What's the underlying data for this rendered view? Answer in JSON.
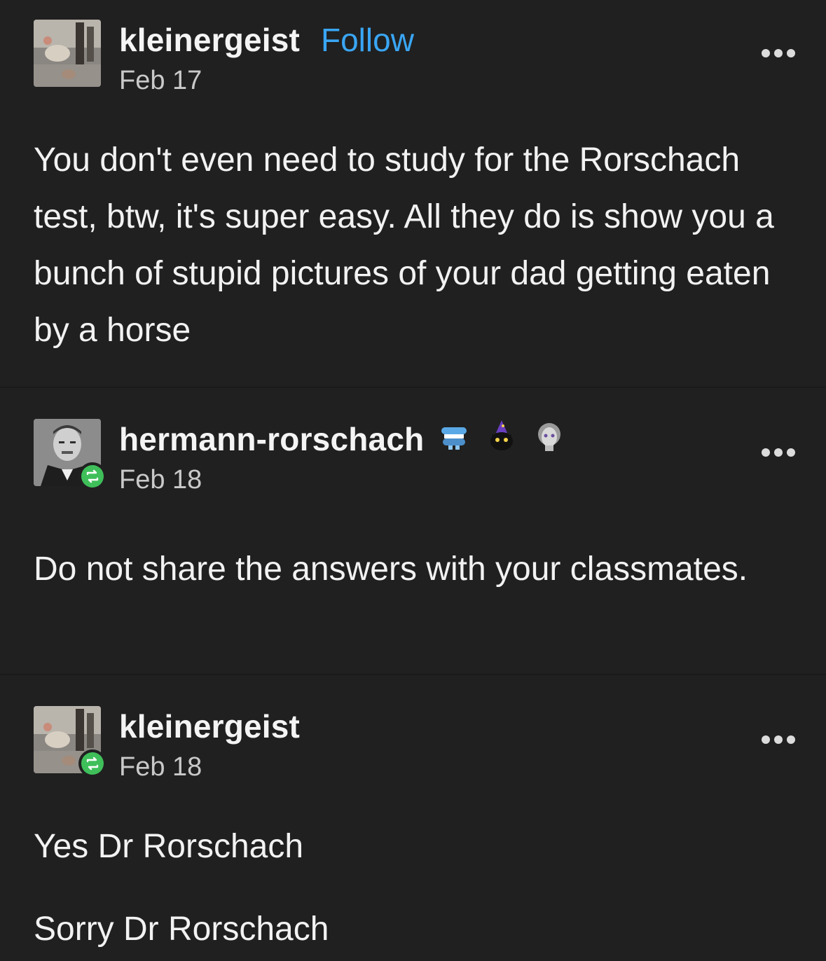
{
  "posts": [
    {
      "username": "kleinergeist",
      "follow_label": "Follow",
      "date": "Feb 17",
      "avatar_icon": "photo-collage-avatar",
      "reblogged": false,
      "paragraphs": [
        "You don't even need to study for the Rorschach test, btw, it's super easy. All they do is show you a bunch of stupid pictures of your dad getting eaten by a horse"
      ]
    },
    {
      "username": "hermann-rorschach",
      "date": "Feb 18",
      "avatar_icon": "portrait-photo-avatar",
      "reblogged": true,
      "badge_icons": [
        "chattering-teeth-badge-icon",
        "wizard-cat-badge-icon",
        "marble-bust-badge-icon"
      ],
      "paragraphs": [
        "Do not share the answers with your classmates."
      ]
    },
    {
      "username": "kleinergeist",
      "date": "Feb 18",
      "avatar_icon": "photo-collage-avatar",
      "reblogged": true,
      "paragraphs": [
        "Yes Dr Rorschach",
        "Sorry Dr Rorschach"
      ]
    }
  ],
  "colors": {
    "background": "#202020",
    "follow_link": "#3aa6f5",
    "reblog_badge": "#3fbf5a",
    "text_primary": "#f2f2f2",
    "text_secondary": "#c9c9c9"
  },
  "more_icon": "ellipsis-icon",
  "reblog_icon": "reblog-icon"
}
